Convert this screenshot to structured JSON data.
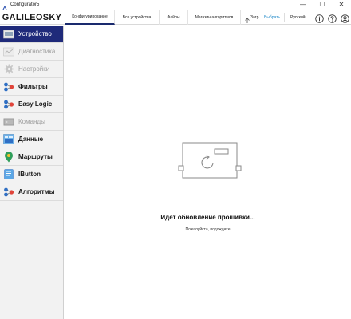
{
  "window": {
    "title": "Configurator5",
    "icon": "app-icon",
    "controls": {
      "minimize": "—",
      "maximize": "☐",
      "close": "✕"
    }
  },
  "header": {
    "logo": "GALILEOSKY",
    "tabs": [
      {
        "label": "Конфигурирование",
        "active": true
      },
      {
        "label": "Все устройства",
        "active": false
      },
      {
        "label": "Файлы",
        "active": false
      },
      {
        "label": "Магазин алгоритмов",
        "active": false
      }
    ],
    "upload_label": "Загр",
    "choose_label": "Выбрать",
    "language": "Русский",
    "icons": [
      "upload-icon",
      "info-icon",
      "help-icon",
      "user-icon"
    ],
    "colors": {
      "accent": "#1f2a7a",
      "link": "#1e88c8"
    }
  },
  "sidebar": {
    "items": [
      {
        "label": "Устройство",
        "icon": "device-icon",
        "state": "active"
      },
      {
        "label": "Диагностика",
        "icon": "diagnostics-icon",
        "state": "disabled"
      },
      {
        "label": "Настройки",
        "icon": "settings-gear-icon",
        "state": "disabled"
      },
      {
        "label": "Фильтры",
        "icon": "filters-icon",
        "state": "enabled"
      },
      {
        "label": "Easy Logic",
        "icon": "easy-logic-icon",
        "state": "enabled"
      },
      {
        "label": "Команды",
        "icon": "commands-icon",
        "state": "disabled"
      },
      {
        "label": "Данные",
        "icon": "data-icon",
        "state": "enabled"
      },
      {
        "label": "Маршруты",
        "icon": "routes-pin-icon",
        "state": "enabled"
      },
      {
        "label": "IButton",
        "icon": "ibutton-icon",
        "state": "enabled"
      },
      {
        "label": "Алгоритмы",
        "icon": "algorithms-icon",
        "state": "enabled"
      }
    ]
  },
  "main": {
    "illustration": "firmware-update-icon",
    "title": "Идет обновление прошивки...",
    "subtitle": "Пожалуйста, подождите"
  }
}
